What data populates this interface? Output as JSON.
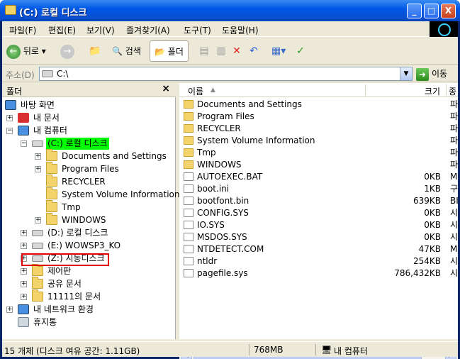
{
  "window": {
    "title": "(C:) 로컬 디스크",
    "controls": [
      "_",
      "□",
      "X"
    ]
  },
  "menu": [
    "파일(F)",
    "편집(E)",
    "보기(V)",
    "즐겨찾기(A)",
    "도구(T)",
    "도움말(H)"
  ],
  "toolbar": {
    "back": "뒤로",
    "search": "검색",
    "folders": "폴더"
  },
  "address": {
    "label": "주소(D)",
    "value": "C:\\",
    "go": "이동"
  },
  "left_pane": {
    "title": "폴더",
    "close": "×",
    "tree": [
      {
        "label": "바탕 화면",
        "icon": "desktop-icon"
      },
      {
        "label": "내 문서",
        "icon": "documents-icon"
      },
      {
        "label": "내 컴퓨터",
        "icon": "computer-icon"
      },
      {
        "label": "(C:) 로컬 디스크",
        "icon": "drive-icon",
        "selected": true
      },
      {
        "label": "Documents and Settings",
        "icon": "folder-icon"
      },
      {
        "label": "Program Files",
        "icon": "folder-icon"
      },
      {
        "label": "RECYCLER",
        "icon": "folder-icon"
      },
      {
        "label": "System Volume Information",
        "icon": "folder-icon"
      },
      {
        "label": "Tmp",
        "icon": "folder-icon"
      },
      {
        "label": "WINDOWS",
        "icon": "folder-icon"
      },
      {
        "label": "(D:) 로컬 디스크",
        "icon": "drive-icon"
      },
      {
        "label": "(E:) WOWSP3_KO",
        "icon": "cd-drive-icon"
      },
      {
        "label": "(Z:) 시동디스크",
        "icon": "network-drive-icon",
        "highlighted": true
      },
      {
        "label": "제어판",
        "icon": "control-panel-icon"
      },
      {
        "label": "공유 문서",
        "icon": "folder-icon"
      },
      {
        "label": "11111의 문서",
        "icon": "folder-icon"
      },
      {
        "label": "내 네트워크 환경",
        "icon": "network-icon"
      },
      {
        "label": "휴지통",
        "icon": "recycle-bin-icon"
      }
    ]
  },
  "right_pane": {
    "columns": {
      "name": "이름",
      "size": "크기",
      "type": "종"
    },
    "files": [
      {
        "name": "Documents and Settings",
        "size": "",
        "type": "파",
        "kind": "folder"
      },
      {
        "name": "Program Files",
        "size": "",
        "type": "파",
        "kind": "folder"
      },
      {
        "name": "RECYCLER",
        "size": "",
        "type": "파",
        "kind": "folder"
      },
      {
        "name": "System Volume Information",
        "size": "",
        "type": "파",
        "kind": "folder"
      },
      {
        "name": "Tmp",
        "size": "",
        "type": "파",
        "kind": "folder"
      },
      {
        "name": "WINDOWS",
        "size": "",
        "type": "파",
        "kind": "folder"
      },
      {
        "name": "AUTOEXEC.BAT",
        "size": "0KB",
        "type": "M",
        "kind": "file"
      },
      {
        "name": "boot.ini",
        "size": "1KB",
        "type": "구",
        "kind": "file"
      },
      {
        "name": "bootfont.bin",
        "size": "639KB",
        "type": "BI",
        "kind": "file"
      },
      {
        "name": "CONFIG.SYS",
        "size": "0KB",
        "type": "시",
        "kind": "file"
      },
      {
        "name": "IO.SYS",
        "size": "0KB",
        "type": "시",
        "kind": "file"
      },
      {
        "name": "MSDOS.SYS",
        "size": "0KB",
        "type": "시",
        "kind": "file"
      },
      {
        "name": "NTDETECT.COM",
        "size": "47KB",
        "type": "M",
        "kind": "file"
      },
      {
        "name": "ntldr",
        "size": "254KB",
        "type": "시",
        "kind": "file"
      },
      {
        "name": "pagefile.sys",
        "size": "786,432KB",
        "type": "시",
        "kind": "file"
      }
    ]
  },
  "status": {
    "objects": "15 개체 (디스크 여유 공간: 1.11GB)",
    "size": "768MB",
    "location": "내 컴퓨터"
  }
}
